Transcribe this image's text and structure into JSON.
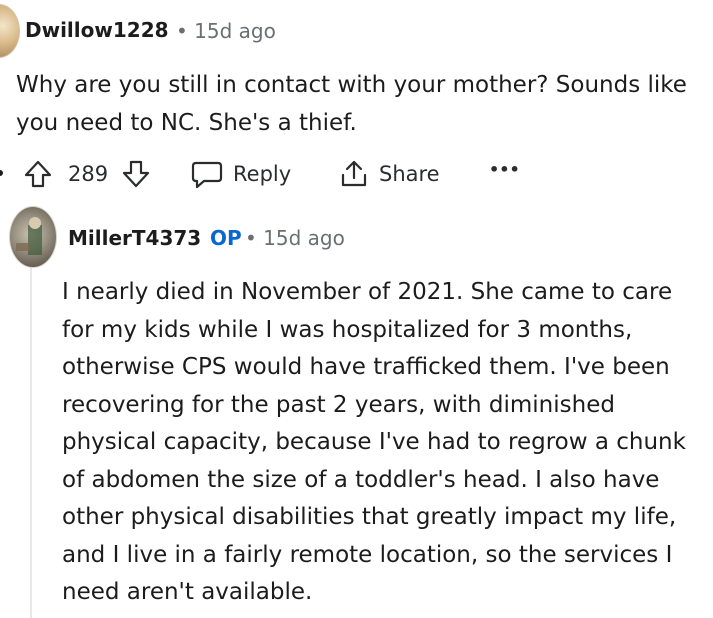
{
  "comments": [
    {
      "username": "Dwillow1228",
      "meta": "• 15d ago",
      "body": "Why are you still in contact with your mother? Sounds like you need to NC. She's a thief.",
      "actions": {
        "score": "289",
        "reply_label": "Reply",
        "share_label": "Share",
        "more_label": "•••"
      }
    },
    {
      "username": "MillerT4373",
      "op_badge": "OP",
      "meta": "• 15d ago",
      "body": "I nearly died in November of 2021. She came to care for my kids while I was hospitalized for 3 months, otherwise CPS would have trafficked them. I've been recovering for the past 2 years, with diminished physical capacity, because I've had to regrow a chunk of abdomen the size of a toddler's head. I also have other physical disabilities that greatly impact my life, and I live in a fairly remote location, so the services I need aren't available."
    }
  ],
  "icons": {
    "upvote": "arrow-up-icon",
    "downvote": "arrow-down-icon",
    "reply": "speech-bubble-icon",
    "share": "share-icon",
    "more": "ellipsis-icon"
  }
}
